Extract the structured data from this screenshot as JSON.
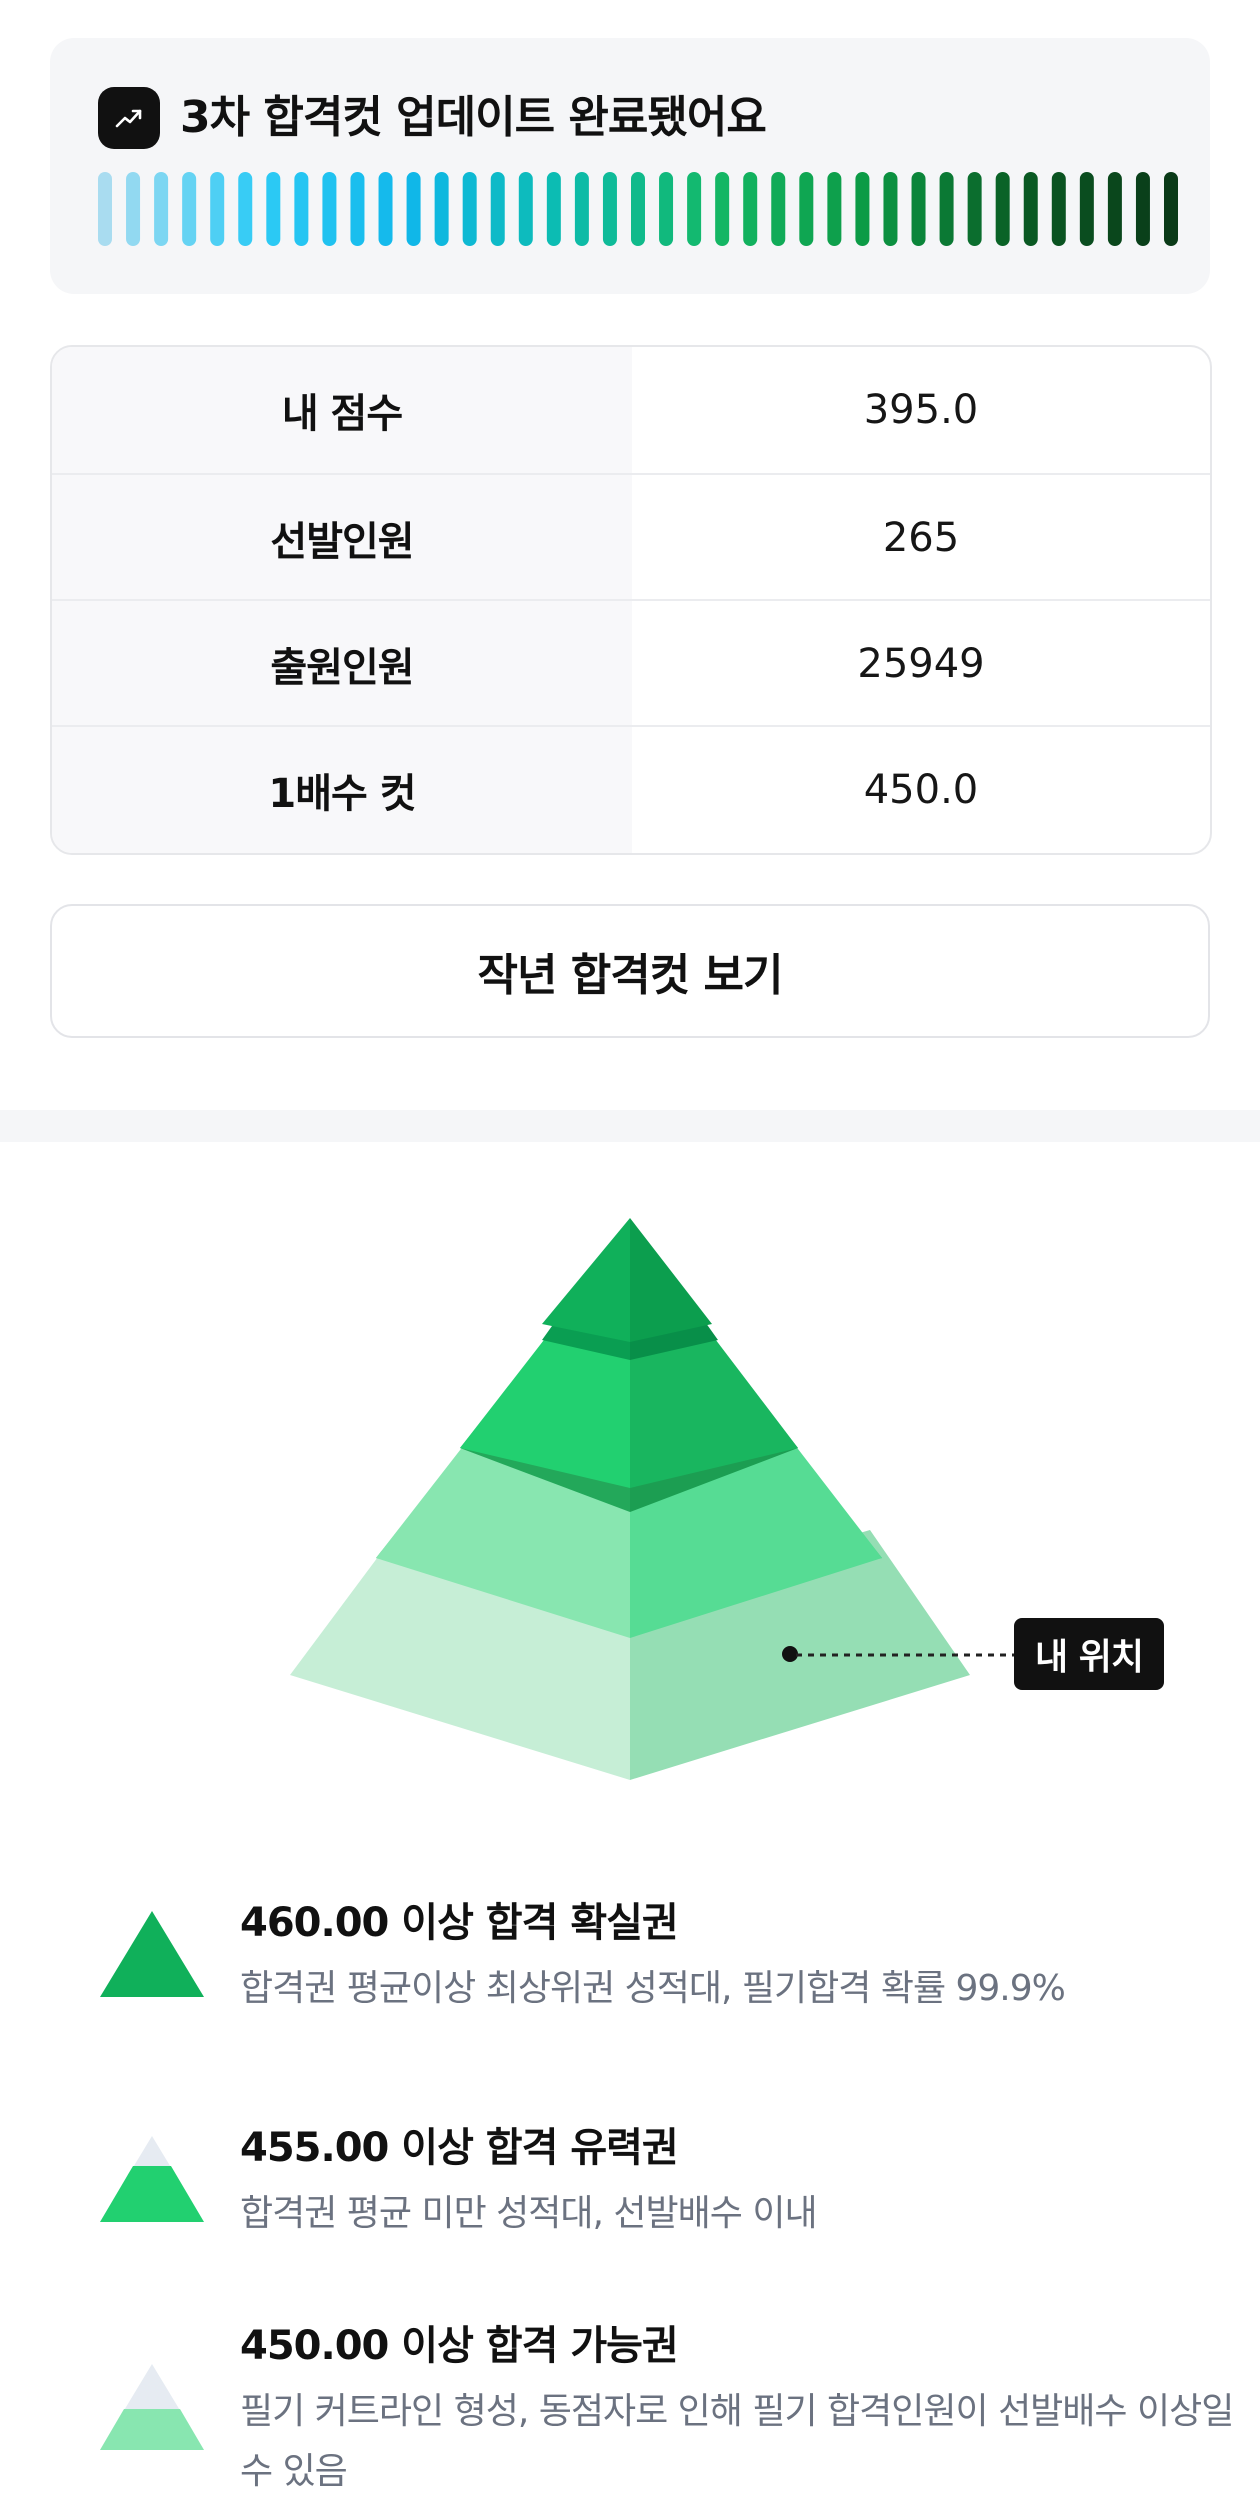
{
  "update_card": {
    "icon": "trending-up-icon",
    "title": "3차 합격컷 업데이트 완료됐어요",
    "gradient_colors": [
      "#a9dcf0",
      "#2ecbf5",
      "#10b7ea",
      "#0cbcb0",
      "#14b866",
      "#0c9a45",
      "#0a5c24",
      "#0a3a18"
    ]
  },
  "score_table": {
    "rows": [
      {
        "label": "내 점수",
        "value": "395.0"
      },
      {
        "label": "선발인원",
        "value": "265"
      },
      {
        "label": "출원인원",
        "value": "25949"
      },
      {
        "label": "1배수 컷",
        "value": "450.0"
      }
    ]
  },
  "previous_cut_button": {
    "label": "작년 합격컷 보기"
  },
  "pyramid": {
    "marker_label": "내 위치",
    "colors": {
      "top": "#10b05a",
      "upper": "#22d070",
      "middle": "#88e6b0",
      "bottom": "#c6eed6"
    }
  },
  "legend": [
    {
      "title": "460.00 이상 합격 확실권",
      "desc": "합격권 평균이상 최상위권 성적대, 필기합격 확률 99.9%"
    },
    {
      "title": "455.00 이상 합격 유력권",
      "desc": "합격권 평균 미만 성적대, 선발배수 이내"
    },
    {
      "title": "450.00 이상 합격 가능권",
      "desc": "필기 커트라인 형성, 동점자로 인해 필기 합격인원이 선발배수 이상일 수 있음"
    }
  ]
}
